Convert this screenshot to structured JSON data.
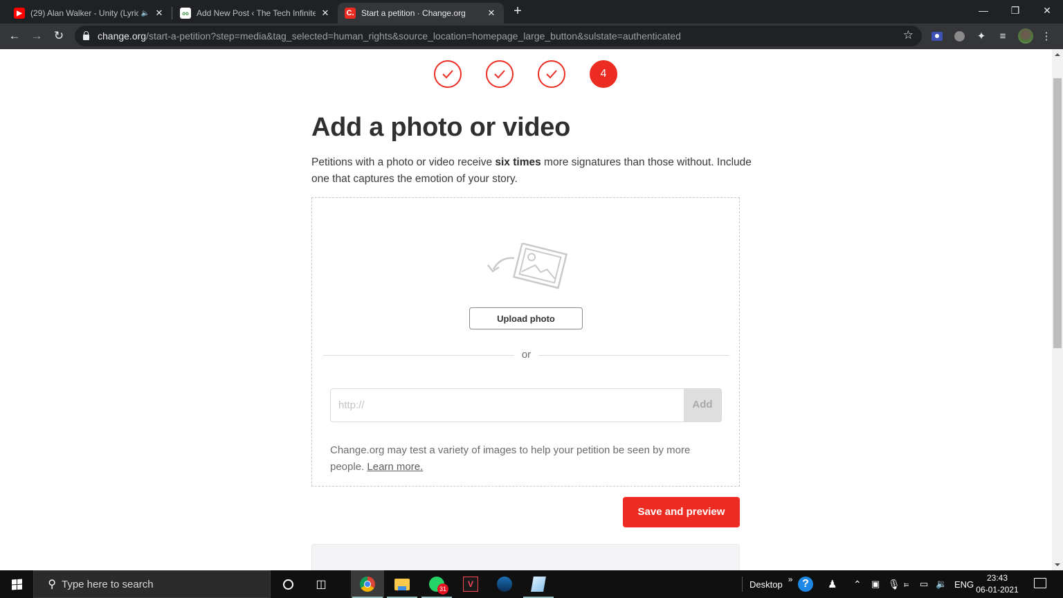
{
  "browser": {
    "tabs": [
      {
        "title": "(29) Alan Walker - Unity (Lyric",
        "favicon": "youtube-icon",
        "audio": true,
        "active": false
      },
      {
        "title": "Add New Post ‹ The Tech Infinite",
        "favicon": "site-icon",
        "active": false
      },
      {
        "title": "Start a petition · Change.org",
        "favicon": "change-org-icon",
        "active": true
      }
    ],
    "new_tab": "+",
    "window_controls": {
      "minimize": "—",
      "restore": "❐",
      "close": "✕"
    },
    "nav": {
      "back": "←",
      "forward": "→",
      "reload": "↻"
    },
    "url": {
      "host": "change.org",
      "path": "/start-a-petition?step=media&tag_selected=human_rights&source_location=homepage_large_button&sulstate=authenticated"
    },
    "bookmark_star": "☆",
    "extensions": [
      "screen-recorder-icon",
      "meet-icon",
      "extensions-puzzle-icon",
      "media-queue-icon"
    ],
    "menu": "⋮"
  },
  "page": {
    "steps": [
      {
        "state": "done",
        "label": "✓"
      },
      {
        "state": "done",
        "label": "✓"
      },
      {
        "state": "done",
        "label": "✓"
      },
      {
        "state": "current",
        "label": "4"
      }
    ],
    "heading": "Add a photo or video",
    "intro": {
      "before": "Petitions with a photo or video receive ",
      "bold": "six times",
      "after": " more signatures than those without. Include one that captures the emotion of your story."
    },
    "upload_button": "Upload photo",
    "divider_text": "or",
    "url_input": {
      "placeholder": "http://",
      "value": ""
    },
    "add_button": "Add",
    "note": "Change.org may test a variety of images to help your petition be seen by more people. ",
    "learn_more": "Learn more.",
    "save_button": "Save and preview",
    "accent_color": "#ec2c22"
  },
  "taskbar": {
    "search_placeholder": "Type here to search",
    "whatsapp_badge": "31",
    "desktop_label": "Desktop",
    "chevron": "»",
    "language": "ENG",
    "time": "23:43",
    "date": "06-01-2021"
  }
}
